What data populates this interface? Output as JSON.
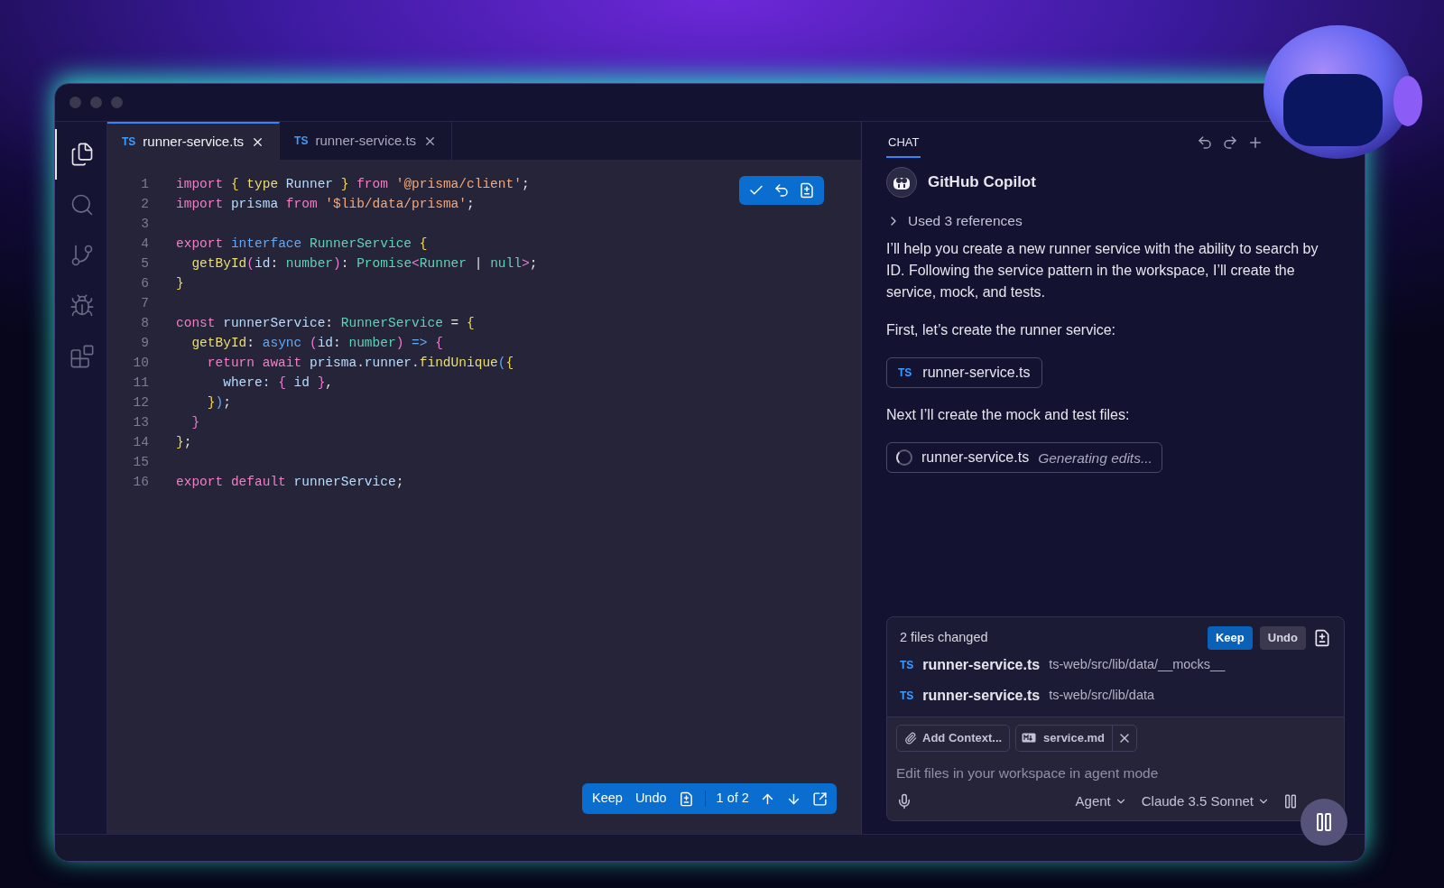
{
  "activity_bar": {
    "items": [
      {
        "kind": "explorer",
        "selected": true
      },
      {
        "kind": "search",
        "selected": false
      },
      {
        "kind": "source-control",
        "selected": false
      },
      {
        "kind": "run-debug",
        "selected": false
      },
      {
        "kind": "extensions",
        "selected": false
      }
    ]
  },
  "editor": {
    "tabs": [
      {
        "lang": "TS",
        "label": "runner-service.ts",
        "selected": true
      },
      {
        "lang": "TS",
        "label": "runner-service.ts",
        "selected": false
      }
    ],
    "lines": [
      {
        "number": "1",
        "tokens": [
          {
            "kind": "keyword",
            "text": "import "
          },
          {
            "kind": "brace1",
            "text": "{ "
          },
          {
            "kind": "function",
            "text": "type"
          },
          {
            "kind": "variable",
            "text": " Runner "
          },
          {
            "kind": "brace1",
            "text": "} "
          },
          {
            "kind": "keyword",
            "text": "from "
          },
          {
            "kind": "string",
            "text": "'@prisma/client'"
          },
          {
            "kind": "plain",
            "text": ";"
          }
        ]
      },
      {
        "number": "2",
        "tokens": [
          {
            "kind": "keyword",
            "text": "import"
          },
          {
            "kind": "variable",
            "text": " prisma "
          },
          {
            "kind": "keyword",
            "text": "from "
          },
          {
            "kind": "string",
            "text": "'$lib/data/prisma'"
          },
          {
            "kind": "plain",
            "text": ";"
          }
        ]
      },
      {
        "number": "3"
      },
      {
        "number": "4",
        "tokens": [
          {
            "kind": "keyword",
            "text": "export "
          },
          {
            "kind": "storage",
            "text": "interface "
          },
          {
            "kind": "type",
            "text": "RunnerService "
          },
          {
            "kind": "brace1",
            "text": "{"
          }
        ]
      },
      {
        "number": "5",
        "tokens": [
          {
            "kind": "function",
            "text": "  getById"
          },
          {
            "kind": "brace2",
            "text": "("
          },
          {
            "kind": "variable",
            "text": "id"
          },
          {
            "kind": "plain",
            "text": ": "
          },
          {
            "kind": "type",
            "text": "number"
          },
          {
            "kind": "brace2",
            "text": ")"
          },
          {
            "kind": "plain",
            "text": ": "
          },
          {
            "kind": "type",
            "text": "Promise"
          },
          {
            "kind": "brace2",
            "text": "<"
          },
          {
            "kind": "type",
            "text": "Runner"
          },
          {
            "kind": "plain",
            "text": " | "
          },
          {
            "kind": "type",
            "text": "null"
          },
          {
            "kind": "brace2",
            "text": ">"
          },
          {
            "kind": "plain",
            "text": ";"
          }
        ]
      },
      {
        "number": "6",
        "tokens": [
          {
            "kind": "brace1",
            "text": "}"
          }
        ]
      },
      {
        "number": "7"
      },
      {
        "number": "8",
        "tokens": [
          {
            "kind": "keyword",
            "text": "const"
          },
          {
            "kind": "variable",
            "text": " runnerService"
          },
          {
            "kind": "plain",
            "text": ": "
          },
          {
            "kind": "type",
            "text": "RunnerService"
          },
          {
            "kind": "plain",
            "text": " = "
          },
          {
            "kind": "brace1",
            "text": "{"
          }
        ]
      },
      {
        "number": "9",
        "tokens": [
          {
            "kind": "function",
            "text": "  getById"
          },
          {
            "kind": "plain",
            "text": ": "
          },
          {
            "kind": "storage",
            "text": "async "
          },
          {
            "kind": "brace2",
            "text": "("
          },
          {
            "kind": "variable",
            "text": "id"
          },
          {
            "kind": "plain",
            "text": ": "
          },
          {
            "kind": "type",
            "text": "number"
          },
          {
            "kind": "brace2",
            "text": ") "
          },
          {
            "kind": "storage",
            "text": "=> "
          },
          {
            "kind": "brace2",
            "text": "{"
          }
        ]
      },
      {
        "number": "10",
        "tokens": [
          {
            "kind": "keyword",
            "text": "    return await"
          },
          {
            "kind": "variable",
            "text": " prisma.runner."
          },
          {
            "kind": "function",
            "text": "findUnique"
          },
          {
            "kind": "brace3",
            "text": "("
          },
          {
            "kind": "brace1",
            "text": "{"
          }
        ]
      },
      {
        "number": "11",
        "tokens": [
          {
            "kind": "variable",
            "text": "      where: "
          },
          {
            "kind": "brace2",
            "text": "{"
          },
          {
            "kind": "variable",
            "text": " id "
          },
          {
            "kind": "brace2",
            "text": "}"
          },
          {
            "kind": "plain",
            "text": ","
          }
        ]
      },
      {
        "number": "12",
        "tokens": [
          {
            "kind": "brace1",
            "text": "    }"
          },
          {
            "kind": "brace3",
            "text": ")"
          },
          {
            "kind": "plain",
            "text": ";"
          }
        ]
      },
      {
        "number": "13",
        "tokens": [
          {
            "kind": "brace2",
            "text": "  }"
          }
        ]
      },
      {
        "number": "14",
        "tokens": [
          {
            "kind": "brace1",
            "text": "}"
          },
          {
            "kind": "plain",
            "text": ";"
          }
        ]
      },
      {
        "number": "15"
      },
      {
        "number": "16",
        "tokens": [
          {
            "kind": "keyword",
            "text": "export default"
          },
          {
            "kind": "variable",
            "text": " runnerService"
          },
          {
            "kind": "plain",
            "text": ";"
          }
        ]
      }
    ],
    "review_bar": {
      "keep": "Keep",
      "undo": "Undo",
      "position": "1 of 2"
    }
  },
  "chat": {
    "tab": "CHAT",
    "agent": "GitHub Copilot",
    "references": {
      "label": "Used 3 references",
      "expanded": false
    },
    "messages": [
      {
        "kind": "text",
        "text": "I’ll help you create a new runner service with the ability to search by ID. Following the service pattern in the workspace, I’ll create the service, mock, and tests."
      },
      {
        "kind": "text",
        "text": "First, let’s create the runner service:"
      },
      {
        "kind": "file",
        "lang": "TS",
        "name": "runner-service.ts"
      },
      {
        "kind": "text",
        "text": "Next I’ll create the mock and test files:"
      },
      {
        "kind": "pending",
        "name": "runner-service.ts",
        "status": "Generating edits..."
      }
    ],
    "changes": {
      "title": "2 files changed",
      "keep": "Keep",
      "undo": "Undo",
      "files": [
        {
          "lang": "TS",
          "name": "runner-service.ts",
          "path": "ts-web/src/lib/data/__mocks__"
        },
        {
          "lang": "TS",
          "name": "runner-service.ts",
          "path": "ts-web/src/lib/data"
        }
      ]
    },
    "input": {
      "add_context": "Add Context...",
      "attachments": [
        {
          "name": "service.md"
        }
      ],
      "placeholder": "Edit files in your workspace in agent mode",
      "mode": "Agent",
      "model": "Claude 3.5 Sonnet"
    }
  }
}
